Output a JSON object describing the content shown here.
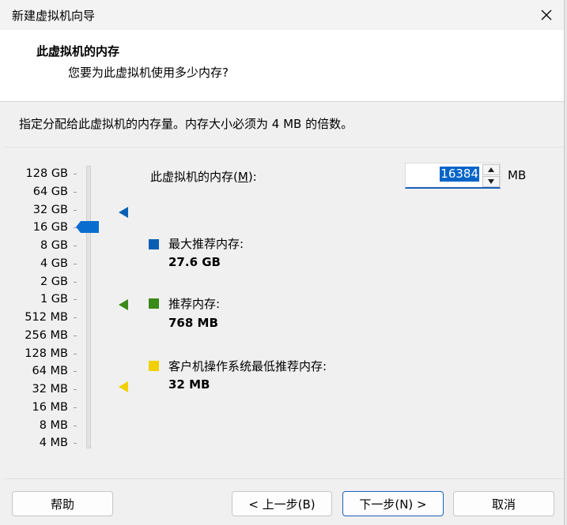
{
  "window": {
    "title": "新建虚拟机向导",
    "close_glyph": "✕"
  },
  "header": {
    "title": "此虚拟机的内存",
    "subtitle": "您要为此虚拟机使用多少内存?"
  },
  "instruction": "指定分配给此虚拟机的内存量。内存大小必须为 4 MB 的倍数。",
  "memory_scale": {
    "labels": [
      "128 GB",
      "64 GB",
      "32 GB",
      "16 GB",
      "8 GB",
      "4 GB",
      "2 GB",
      "1 GB",
      "512 MB",
      "256 MB",
      "128 MB",
      "64 MB",
      "32 MB",
      "16 MB",
      "8 MB",
      "4 MB"
    ],
    "selected": "16 GB"
  },
  "memory_field": {
    "label_prefix": "此虚拟机的内存(",
    "label_key": "M",
    "label_suffix": "):",
    "value": "16384",
    "unit": "MB"
  },
  "legend": {
    "max": {
      "label": "最大推荐内存:",
      "value": "27.6 GB",
      "color": "#0a5fb4"
    },
    "recommended": {
      "label": "推荐内存:",
      "value": "768 MB",
      "color": "#3a8a1a"
    },
    "guest_min": {
      "label": "客户机操作系统最低推荐内存:",
      "value": "32 MB",
      "color": "#f0d000"
    }
  },
  "buttons": {
    "help": "帮助",
    "back": "< 上一步(B)",
    "next": "下一步(N) >",
    "cancel": "取消"
  }
}
